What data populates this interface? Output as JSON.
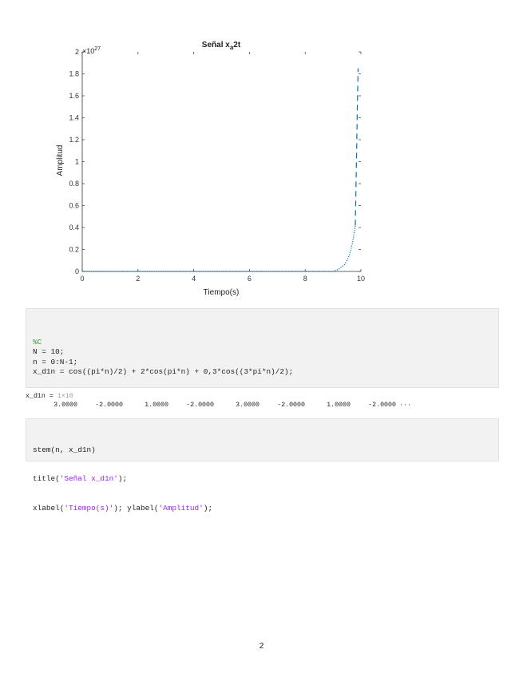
{
  "chart_data": {
    "type": "line",
    "title_main": "Señal x",
    "title_sub": "a",
    "title_tail": "2t",
    "xlabel": "Tiempo(s)",
    "ylabel": "Amplitud",
    "exponent_base": "×10",
    "exponent_power": "27",
    "xlim": [
      0,
      10
    ],
    "ylim": [
      0,
      2
    ],
    "x_ticks": [
      0,
      2,
      4,
      6,
      8,
      10
    ],
    "x_tick_labels": [
      "0",
      "2",
      "4",
      "6",
      "8",
      "10"
    ],
    "y_ticks": [
      0,
      0.2,
      0.4,
      0.6,
      0.8,
      1,
      1.2,
      1.4,
      1.6,
      1.8,
      2
    ],
    "y_tick_labels": [
      "0",
      "0.2",
      "0.4",
      "0.6",
      "0.8",
      "1",
      "1.2",
      "1.4",
      "1.6",
      "1.8",
      "2"
    ],
    "series": [
      {
        "color": "#0072bd",
        "style": "dotted",
        "x": [
          0,
          2,
          4,
          6,
          8,
          9.0,
          9.2,
          9.4,
          9.5,
          9.6,
          9.7,
          9.75,
          9.8
        ],
        "y": [
          0,
          0,
          0,
          0,
          0,
          0.0,
          0.02,
          0.06,
          0.1,
          0.16,
          0.26,
          0.34,
          0.42
        ]
      },
      {
        "color": "#0072bd",
        "style": "dashed",
        "x": [
          9.8,
          9.82,
          9.84,
          9.86,
          9.88,
          9.9
        ],
        "y": [
          0.42,
          0.7,
          1.0,
          1.3,
          1.6,
          1.85
        ]
      }
    ]
  },
  "code_block_1": {
    "lines": [
      {
        "kind": "comment",
        "text": "%C"
      },
      {
        "kind": "code",
        "text": "N = 10;"
      },
      {
        "kind": "code",
        "text": "n = 0:N-1;"
      },
      {
        "kind": "code",
        "text": "x_d1n = cos((pi*n)/2) + 2*cos(pi*n) + 0,3*cos((3*pi*n)/2);"
      }
    ]
  },
  "output": {
    "var_name": "x_d1n = ",
    "size": "1×10",
    "values": [
      "3.0000",
      "-2.0000",
      "1.0000",
      "-2.0000",
      "3.0000",
      "-2.0000",
      "1.0000",
      "-2.0000"
    ],
    "more": "···"
  },
  "code_block_2": {
    "line1": "stem(n, x_d1n)",
    "line2_pre": "title(",
    "line2_str": "'Señal x_d1n'",
    "line2_post": ");",
    "line3_pre": "xlabel(",
    "line3_str1": "'Tiempo(s)'",
    "line3_mid": "); ylabel(",
    "line3_str2": "'Amplitud'",
    "line3_post": ");"
  },
  "page_number": "2"
}
